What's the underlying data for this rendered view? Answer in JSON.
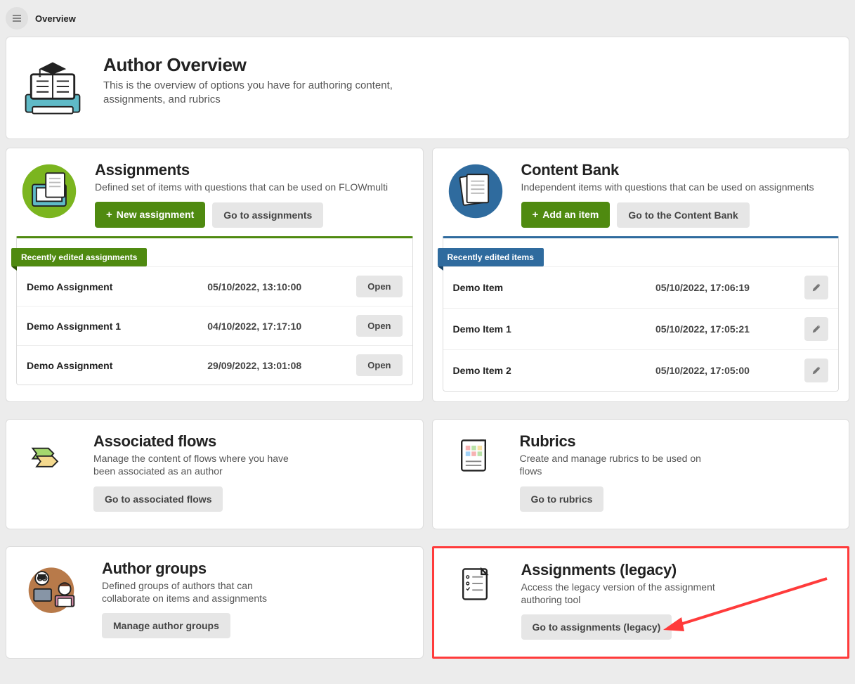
{
  "breadcrumb": "Overview",
  "hero": {
    "title": "Author Overview",
    "sub": "This is the overview of options you have for authoring content, assignments, and rubrics"
  },
  "assignments": {
    "title": "Assignments",
    "sub": "Defined set of items with questions that can be used on FLOWmulti",
    "new_btn": "New assignment",
    "goto_btn": "Go to assignments",
    "ribbon": "Recently edited assignments",
    "open_label": "Open",
    "rows": [
      {
        "name": "Demo Assignment",
        "date": "05/10/2022, 13:10:00"
      },
      {
        "name": "Demo Assignment 1",
        "date": "04/10/2022, 17:17:10"
      },
      {
        "name": "Demo Assignment",
        "date": "29/09/2022, 13:01:08"
      }
    ]
  },
  "content_bank": {
    "title": "Content Bank",
    "sub": "Independent items with questions that can be used on assignments",
    "add_btn": "Add an item",
    "goto_btn": "Go to the Content Bank",
    "ribbon": "Recently edited items",
    "rows": [
      {
        "name": "Demo Item",
        "date": "05/10/2022, 17:06:19"
      },
      {
        "name": "Demo Item 1",
        "date": "05/10/2022, 17:05:21"
      },
      {
        "name": "Demo Item 2",
        "date": "05/10/2022, 17:05:00"
      }
    ]
  },
  "associated_flows": {
    "title": "Associated flows",
    "sub": "Manage the content of flows where you have been associated as an author",
    "btn": "Go to associated flows"
  },
  "rubrics": {
    "title": "Rubrics",
    "sub": "Create and manage rubrics to be used on flows",
    "btn": "Go to rubrics"
  },
  "author_groups": {
    "title": "Author groups",
    "sub": "Defined groups of authors that can collaborate on items and assignments",
    "btn": "Manage author groups"
  },
  "legacy": {
    "title": "Assignments (legacy)",
    "sub": "Access the legacy version of the assignment authoring tool",
    "btn": "Go to assignments (legacy)"
  }
}
